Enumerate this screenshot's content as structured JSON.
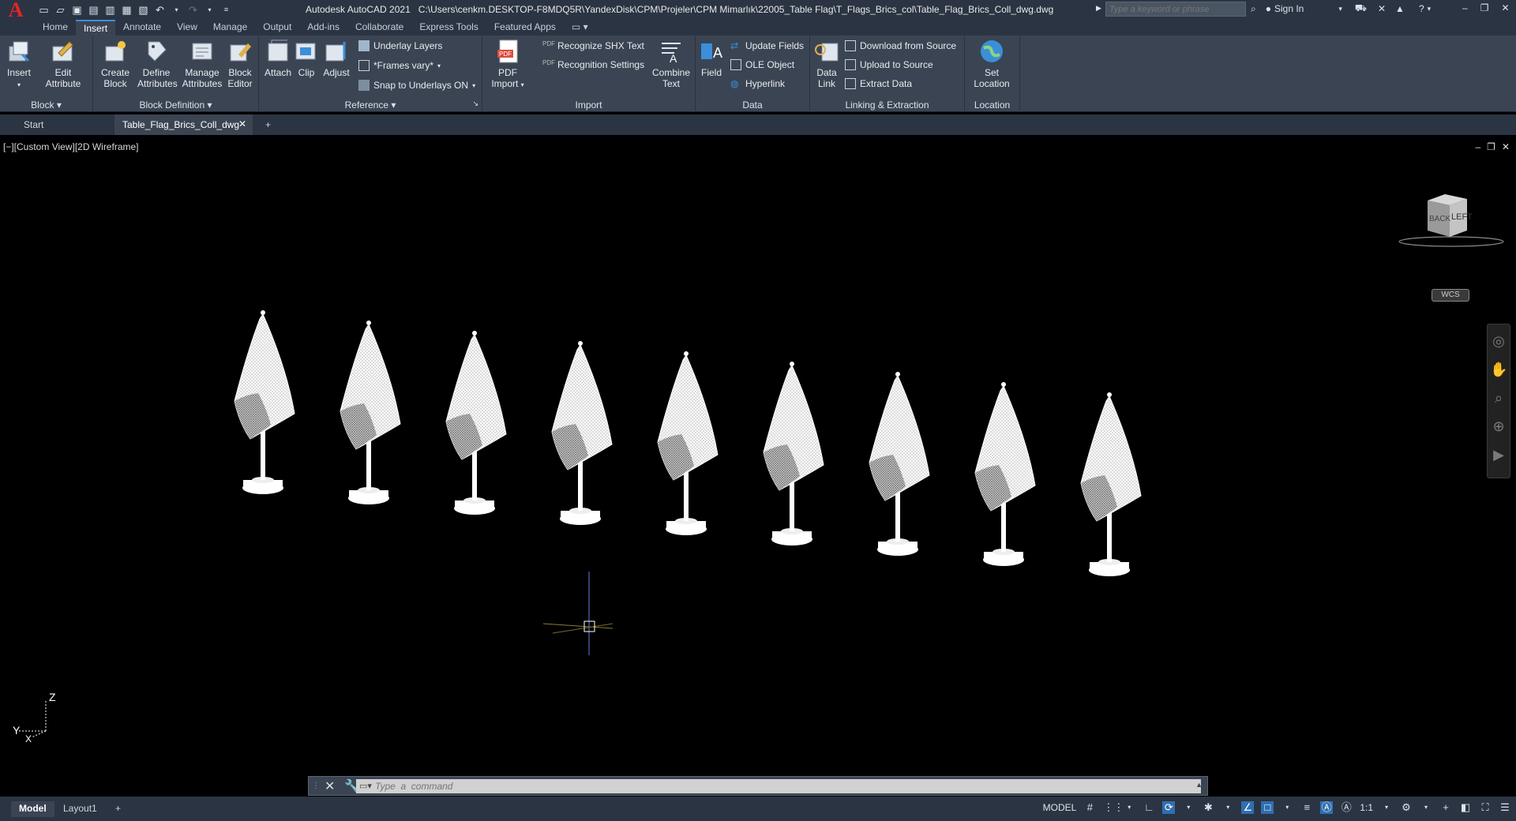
{
  "titlebar": {
    "app_name": "Autodesk AutoCAD 2021",
    "file_path": "C:\\Users\\cenkm.DESKTOP-F8MDQ5R\\YandexDisk\\CPM\\Projeler\\CPM Mimarlık\\22005_Table Flag\\T_Flags_Brics_col\\Table_Flag_Brics_Coll_dwg.dwg",
    "search_placeholder": "Type a keyword or phrase",
    "sign_in": "Sign In"
  },
  "menu_tabs": [
    "Home",
    "Insert",
    "Annotate",
    "View",
    "Manage",
    "Output",
    "Add-ins",
    "Collaborate",
    "Express Tools",
    "Featured Apps"
  ],
  "active_tab": "Insert",
  "ribbon": {
    "block": {
      "label": "Block",
      "insert": "Insert",
      "edit_attribute": "Edit Attribute"
    },
    "block_definition": {
      "label": "Block Definition",
      "create_block": "Create Block",
      "define_attributes": "Define Attributes",
      "manage_attributes": "Manage Attributes",
      "block_editor": "Block Editor"
    },
    "reference": {
      "label": "Reference",
      "attach": "Attach",
      "clip": "Clip",
      "adjust": "Adjust",
      "underlay_layers": "Underlay Layers",
      "frames_vary": "*Frames vary*",
      "snap_to_underlays": "Snap to Underlays ON"
    },
    "import": {
      "label": "Import",
      "pdf_import": "PDF Import",
      "recognize_shx": "Recognize SHX Text",
      "recognition_settings": "Recognition Settings",
      "combine_text": "Combine Text"
    },
    "data": {
      "label": "Data",
      "field": "Field",
      "update_fields": "Update Fields",
      "ole_object": "OLE Object",
      "hyperlink": "Hyperlink"
    },
    "linking": {
      "label": "Linking & Extraction",
      "data_link": "Data Link",
      "download_from_source": "Download from Source",
      "upload_to_source": "Upload to Source",
      "extract_data": "Extract  Data"
    },
    "location": {
      "label": "Location",
      "set_location": "Set Location"
    }
  },
  "doc_tabs": [
    "Start",
    "Table_Flag_Brics_Coll_dwg"
  ],
  "viewport": {
    "label": "[−][Custom View][2D Wireframe]",
    "wcs": "WCS",
    "viewcube_left": "LEFT",
    "viewcube_back": "BACK",
    "ucs_z": "Z",
    "ucs_y": "Y",
    "ucs_x": "X",
    "flag_count": 9
  },
  "command": {
    "placeholder": "Type  a  command"
  },
  "status": {
    "layouts": [
      "Model",
      "Layout1"
    ],
    "model": "MODEL",
    "scale": "1:1"
  }
}
